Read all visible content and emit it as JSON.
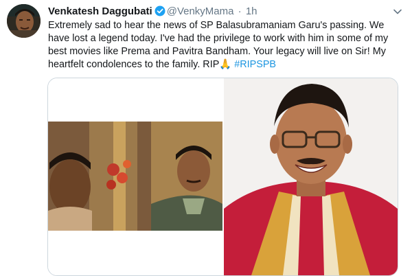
{
  "tweet": {
    "author_name": "Venkatesh Daggubati",
    "handle": "@VenkyMama",
    "separator": "·",
    "time": "1h",
    "text_main": "Extremely sad to hear the news of SP Balasubramaniam Garu's passing. We have lost a legend today. I've had the privilege to work with him in some of my best movies like Prema and Pavitra Bandham. Your legacy will live on Sir! My heartfelt condolences to the family. RIP",
    "emoji": "🙏",
    "hashtag": "#RIPSPB"
  },
  "icons": {
    "verified": "verified-badge-icon",
    "caret": "chevron-down-icon"
  },
  "colors": {
    "link": "#1b95e0",
    "verified": "#1da1f2",
    "secondary_text": "#657786",
    "border": "#ccd6dd"
  }
}
